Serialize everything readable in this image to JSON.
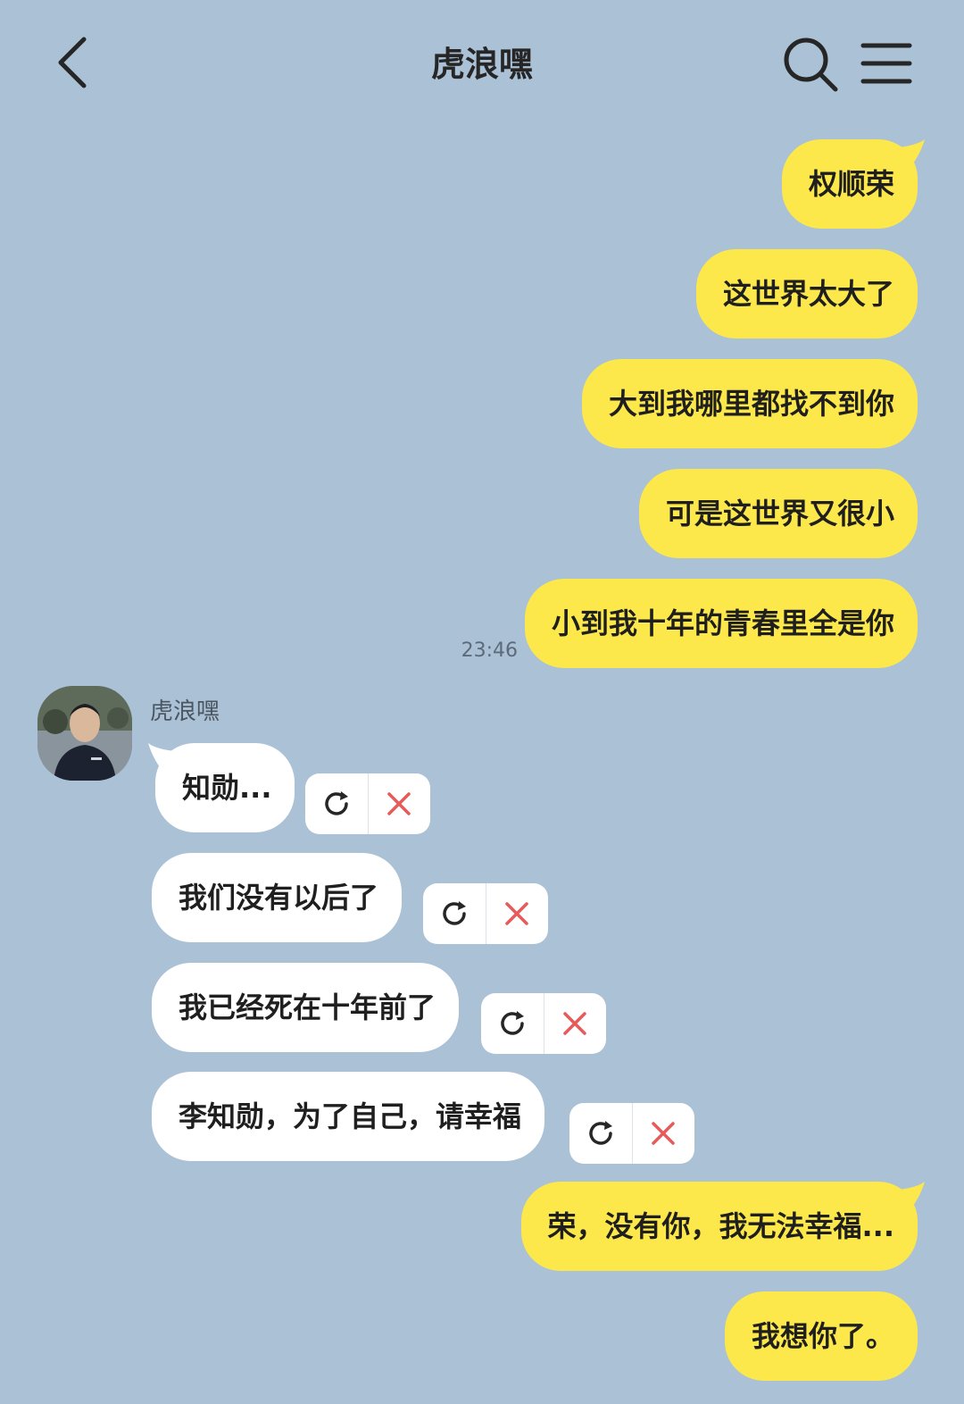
{
  "header": {
    "title": "虎浪嘿",
    "back_icon": "chevron-left-icon",
    "search_icon": "search-icon",
    "menu_icon": "menu-icon"
  },
  "colors": {
    "background": "#abc1d6",
    "my_bubble": "#fde84b",
    "their_bubble": "#ffffff",
    "delete_icon": "#e85a5a"
  },
  "messages_me_top": [
    "权顺荣",
    "这世界太大了",
    "大到我哪里都找不到你",
    "可是这世界又很小",
    "小到我十年的青春里全是你"
  ],
  "timestamp": "23:46",
  "sender": {
    "name": "虎浪嘿"
  },
  "messages_them": [
    "知勋...",
    "我们没有以后了",
    "我已经死在十年前了",
    "李知勋，为了自己，请幸福"
  ],
  "failed_actions": {
    "retry_icon": "retry-icon",
    "delete_icon": "delete-icon"
  },
  "messages_me_bottom": [
    "荣，没有你，我无法幸福...",
    "我想你了。"
  ]
}
